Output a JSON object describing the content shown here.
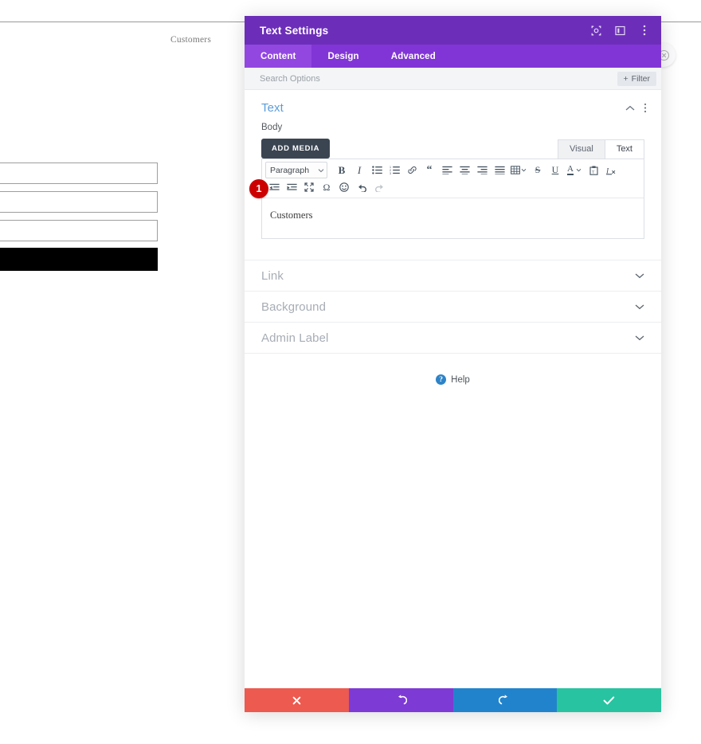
{
  "background": {
    "label_customers": "Customers",
    "close_icon": "close-circle-icon",
    "fields": [
      {
        "name": "field-1",
        "value": "",
        "placeholder": ""
      },
      {
        "name": "field-2",
        "value": "",
        "placeholder": ""
      },
      {
        "name": "field-3",
        "value": "",
        "placeholder": ""
      }
    ],
    "submit_label": ""
  },
  "panel": {
    "title": "Text Settings",
    "titlebar_icons": [
      {
        "name": "target-icon",
        "glyph": "target"
      },
      {
        "name": "layout-panel-icon",
        "glyph": "panel"
      },
      {
        "name": "more-options-icon",
        "glyph": "dots-vertical"
      }
    ],
    "tabs": [
      {
        "label": "Content",
        "active": true
      },
      {
        "label": "Design",
        "active": false
      },
      {
        "label": "Advanced",
        "active": false
      }
    ],
    "search": {
      "placeholder": "Search Options",
      "value": ""
    },
    "filter_button": {
      "label": "Filter",
      "icon": "plus-icon"
    },
    "sections": {
      "open": {
        "title": "Text",
        "collapse_icon": "chevron-up-icon",
        "more_icon": "more-options-icon",
        "field_label": "Body",
        "add_media_label": "ADD MEDIA",
        "editor_tabs": [
          {
            "label": "Visual",
            "active": false
          },
          {
            "label": "Text",
            "active": true
          }
        ],
        "format_select": {
          "value": "Paragraph",
          "caret": "caret-down-icon"
        },
        "toolbar_row1": [
          {
            "name": "bold-icon",
            "label": "B"
          },
          {
            "name": "italic-icon",
            "label": "I"
          },
          {
            "name": "bulleted-list-icon",
            "label": ""
          },
          {
            "name": "numbered-list-icon",
            "label": ""
          },
          {
            "name": "link-icon",
            "label": ""
          },
          {
            "name": "blockquote-icon",
            "label": ""
          },
          {
            "name": "align-left-icon",
            "label": ""
          },
          {
            "name": "align-center-icon",
            "label": ""
          },
          {
            "name": "align-right-icon",
            "label": ""
          },
          {
            "name": "align-justify-icon",
            "label": ""
          },
          {
            "name": "table-icon",
            "label": ""
          },
          {
            "name": "strikethrough-icon",
            "label": "S"
          },
          {
            "name": "underline-icon",
            "label": "U"
          },
          {
            "name": "text-color-icon",
            "label": "A"
          },
          {
            "name": "paste-as-text-icon",
            "label": ""
          },
          {
            "name": "clear-formatting-icon",
            "label": ""
          }
        ],
        "toolbar_row2": [
          {
            "name": "outdent-icon",
            "label": ""
          },
          {
            "name": "indent-icon",
            "label": ""
          },
          {
            "name": "fullscreen-icon",
            "label": ""
          },
          {
            "name": "special-character-icon",
            "label": "Ω"
          },
          {
            "name": "emoji-icon",
            "label": ""
          },
          {
            "name": "undo-icon",
            "label": ""
          },
          {
            "name": "redo-icon",
            "label": ""
          }
        ],
        "content_text": "Customers"
      },
      "collapsed": [
        {
          "title": "Link",
          "icon": "chevron-down-icon"
        },
        {
          "title": "Background",
          "icon": "chevron-down-icon"
        },
        {
          "title": "Admin Label",
          "icon": "chevron-down-icon"
        }
      ]
    },
    "help": {
      "label": "Help",
      "icon": "question-mark-icon",
      "icon_glyph": "?"
    },
    "footer": [
      {
        "name": "cancel-button",
        "icon": "close-x-icon",
        "color": "#ec5a50"
      },
      {
        "name": "undo-button",
        "icon": "undo-arrow-icon",
        "color": "#7e3ad4"
      },
      {
        "name": "redo-button",
        "icon": "redo-arrow-icon",
        "color": "#2283cd"
      },
      {
        "name": "save-button",
        "icon": "checkmark-icon",
        "color": "#28c3a0"
      }
    ]
  },
  "annotations": {
    "step_badge": "1"
  },
  "colors": {
    "titlebar": "#6c2eb9",
    "tabbar": "#8235d6",
    "tab_active": "#9248e0",
    "section_title": "#5b9dd9",
    "badge_red": "#cc0000"
  }
}
